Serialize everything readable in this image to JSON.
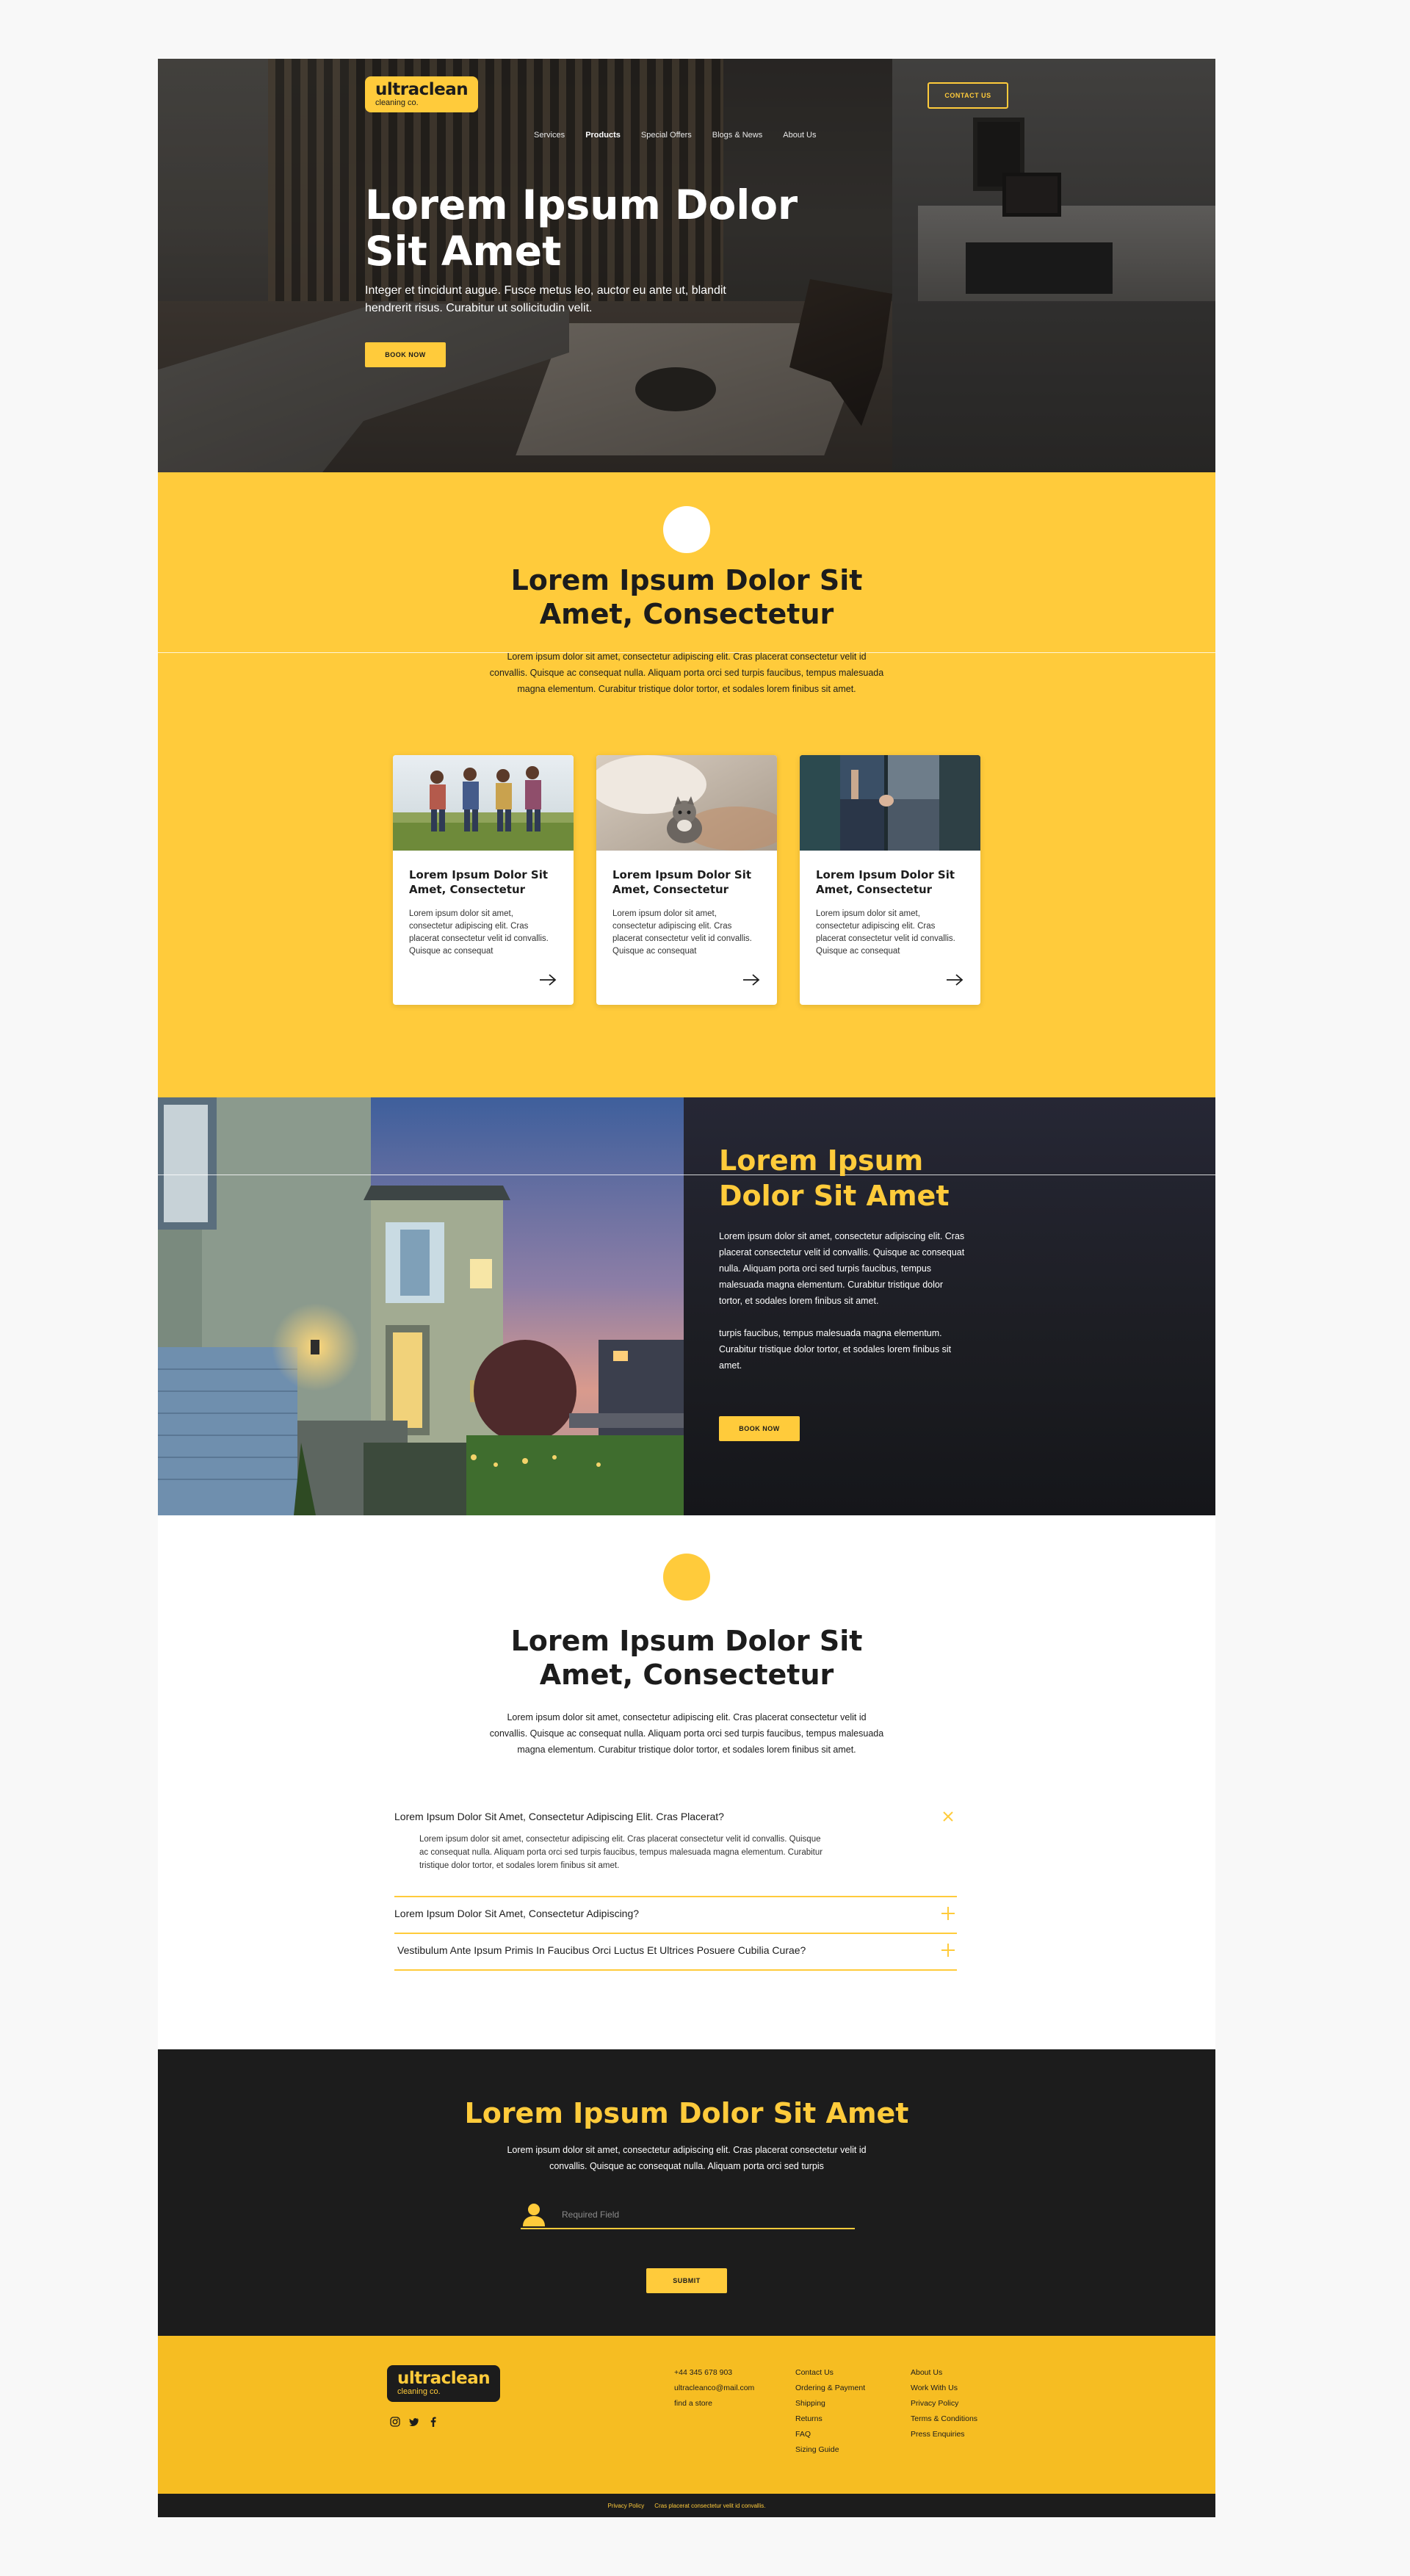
{
  "header": {
    "logo_name": "ultraclean",
    "logo_sub": "cleaning co.",
    "nav": [
      "Services",
      "Products",
      "Special Offers",
      "Blogs & News",
      "About Us"
    ],
    "contact_label": "CONTACT US"
  },
  "hero": {
    "title": "Lorem Ipsum Dolor Sit Amet",
    "subtitle": "Integer et tincidunt augue. Fusce metus leo, auctor eu ante ut, blandit hendrerit risus. Curabitur ut sollicitudin velit.",
    "cta": "BOOK NOW"
  },
  "services": {
    "title": "Lorem Ipsum Dolor Sit Amet, Consectetur",
    "text": "Lorem ipsum dolor sit amet, consectetur adipiscing elit. Cras placerat consectetur velit id convallis. Quisque ac consequat nulla. Aliquam porta orci sed turpis faucibus, tempus malesuada magna elementum. Curabitur tristique dolor tortor, et sodales lorem finibus sit amet.",
    "cards": [
      {
        "title": "Lorem Ipsum Dolor Sit Amet, Consectetur",
        "text": "Lorem ipsum dolor sit amet, consectetur adipiscing elit. Cras placerat consectetur velit id convallis. Quisque ac consequat"
      },
      {
        "title": "Lorem Ipsum Dolor Sit Amet, Consectetur",
        "text": "Lorem ipsum dolor sit amet, consectetur adipiscing elit. Cras placerat consectetur velit id convallis. Quisque ac consequat"
      },
      {
        "title": "Lorem Ipsum Dolor Sit Amet, Consectetur",
        "text": "Lorem ipsum dolor sit amet, consectetur adipiscing elit. Cras placerat consectetur velit id convallis. Quisque ac consequat"
      }
    ]
  },
  "feature": {
    "title": "Lorem Ipsum Dolor Sit Amet",
    "para1": "Lorem ipsum dolor sit amet, consectetur adipiscing elit. Cras placerat consectetur velit id convallis. Quisque ac consequat nulla. Aliquam porta orci sed turpis faucibus, tempus malesuada magna elementum. Curabitur tristique dolor tortor, et sodales lorem finibus sit amet.",
    "para2": "turpis faucibus, tempus malesuada magna elementum. Curabitur tristique dolor tortor, et sodales lorem finibus sit amet.",
    "cta": "BOOK NOW"
  },
  "faq": {
    "title": "Lorem Ipsum Dolor Sit Amet, Consectetur",
    "text": "Lorem ipsum dolor sit amet, consectetur adipiscing elit. Cras placerat consectetur velit id convallis. Quisque ac consequat nulla. Aliquam porta orci sed turpis faucibus, tempus malesuada magna elementum. Curabitur tristique dolor tortor, et sodales lorem finibus sit amet.",
    "items": [
      {
        "question": "Lorem Ipsum Dolor Sit Amet, Consectetur Adipiscing Elit. Cras Placerat?",
        "answer": "Lorem ipsum dolor sit amet, consectetur adipiscing elit. Cras placerat consectetur velit id convallis. Quisque ac consequat nulla. Aliquam porta orci sed turpis faucibus, tempus malesuada magna elementum. Curabitur tristique dolor tortor, et sodales lorem finibus sit amet.",
        "open": true
      },
      {
        "question": "Lorem Ipsum Dolor Sit Amet, Consectetur Adipiscing?",
        "open": false
      },
      {
        "question": "Vestibulum Ante Ipsum Primis In Faucibus Orci Luctus Et Ultrices Posuere Cubilia Curae?",
        "open": false
      }
    ]
  },
  "newsletter": {
    "title": "Lorem Ipsum Dolor Sit Amet",
    "text": "Lorem ipsum dolor sit amet, consectetur adipiscing elit. Cras placerat consectetur velit id convallis. Quisque ac consequat nulla. Aliquam porta orci sed turpis",
    "placeholder": "Required Field",
    "submit": "SUBMIT"
  },
  "footer": {
    "logo_name": "ultraclean",
    "logo_sub": "cleaning co.",
    "socials": [
      "instagram-icon",
      "twitter-icon",
      "facebook-icon"
    ],
    "contact": [
      "+44 345 678 903",
      "ultracleanco@mail.com",
      "find a store"
    ],
    "links1": [
      "Contact Us",
      "Ordering & Payment",
      "Shipping",
      "Returns",
      "FAQ",
      "Sizing Guide"
    ],
    "links2": [
      "About Us",
      "Work With Us",
      "Privacy Policy",
      "Terms & Conditions",
      "Press Enquiries"
    ],
    "bottom": [
      "Privacy Policy",
      "Cras placerat consectetur velit id convallis."
    ]
  },
  "colors": {
    "accent": "#ffcb3b",
    "footer": "#f6bd22",
    "dark": "#1c1c1c"
  }
}
